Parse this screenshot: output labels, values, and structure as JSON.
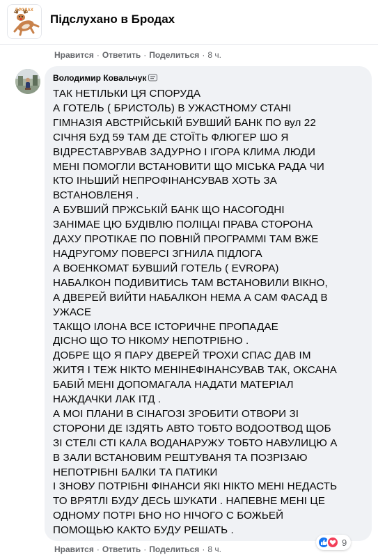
{
  "group": {
    "title": "Підслухано в Бродах",
    "logo_text": "БРОДАХ"
  },
  "top_actions": {
    "like": "Нравится",
    "reply": "Ответить",
    "share": "Поделиться",
    "time": "8 ч."
  },
  "comment": {
    "author": "Володимир Ковальчук",
    "badge_icon": "community-badge-icon",
    "lines": [
      "ТАК НЕТІЛЬКИ ЦЯ СПОРУДА",
      "А ГОТЕЛЬ ( БРИСТОЛЬ) В УЖАСТНОМУ СТАНІ",
      "ГІМНАЗІЯ АВСТРІЙСЬКІЙ БУВШИЙ БАНК ПО вул 22",
      "СІЧНЯ БУД 59 ТАМ ДЕ СТОЇТЬ ФЛЮГЕР ШО Я",
      "ВІДРЕСТАВРУВАВ ЗАДУРНО І ІГОРА КЛИМА ЛЮДИ",
      "МЕНІ ПОМОГЛИ ВСТАНОВИТИ ЩО МІСЬКА РАДА ЧИ",
      "КТО ІНЬШИЙ НЕПРОФІНАНСУВАВ ХОТЬ ЗА",
      "ВСТАНОВЛЕНЯ .",
      "А БУВШИЙ ПРЖСЬКІЙ БАНК ЩО НАСОГОДНІ",
      "ЗАНІМАЕ ЦЮ БУДІВЛЮ ПОЛІЦАІ ПРАВА СТОРОНА",
      "ДАХУ ПРОТІКАЕ ПО ПОВНІЙ ПРОГРАММІ ТАМ ВЖЕ",
      "НАДРУГОМУ ПОВЕРСІ ЗГНИЛА ПІДЛОГА",
      "А ВОЕНКОМАТ БУВШИЙ ГОТЕЛЬ ( EVROPA)",
      "НАБАЛКОН ПОДИВИТИСЬ ТАМ ВСТАНОВИЛИ ВІКНО,",
      "А ДВЕРЕЙ ВИЙТИ НАБАЛКОН НЕМА А САМ ФАСАД В",
      "УЖАСЕ",
      "ТАКЩО ІЛОНА ВСЕ ІСТОРИЧНЕ ПРОПАДАЕ",
      "ДІСНО ЩО ТО НІКОМУ НЕПОТРІБНО .",
      "ДОБРЕ ЩО Я ПАРУ ДВЕРЕЙ ТРОХИ СПАС ДАВ ІМ",
      "ЖИТЯ І ТЕЖ НІКТО МЕНІНЕФІНАНСУВАВ ТАК, ОКСАНА",
      "БАБІЙ МЕНІ ДОПОМАГАЛА НАДАТИ МАТЕРІАЛ",
      "НАЖДАЧКИ ЛАК ІТД .",
      "А МОІ ПЛАНИ В СІНАГОЗІ ЗРОБИТИ ОТВОРИ ЗІ",
      "СТОРОНИ ДЕ ІЗДЯТЬ АВТО ТОБТО ВОДООТВОД ЩОБ",
      "ЗІ СТЕЛІ СТІ КАЛА ВОДАНАРУЖУ ТОБТО НАВУЛИЦЮ А",
      "В ЗАЛИ ВСТАНОВИМ РЕШТУВАНЯ ТА ПОЗРІЗАЮ",
      "НЕПОТРІБНІ БАЛКИ ТА ПАТИКИ",
      "І ЗНОВУ ПОТРІБНІ ФІНАНСИ ЯКІ НІКТО МЕНІ НЕДАСТЬ",
      "ТО ВРЯТЛІ БУДУ ДЕСЬ ШУКАТИ . НАПЕВНЕ МЕНІ ЦЕ",
      "ОДНОМУ ПОТРІ БНО НО НІЧОГО С БОЖЬЕЙ",
      "ПОМОЩЬЮ КАКТО БУДУ РЕШАТЬ ."
    ]
  },
  "reactions": {
    "icons": [
      "like-icon",
      "love-icon"
    ],
    "count": "9"
  },
  "bottom_actions": {
    "like": "Нравится",
    "reply": "Ответить",
    "share": "Поделиться",
    "time": "8 ч."
  }
}
